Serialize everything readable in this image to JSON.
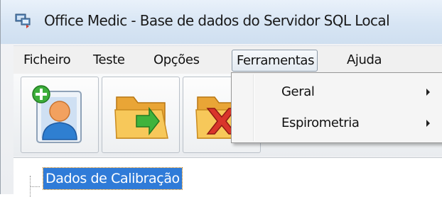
{
  "window": {
    "title": "Office Medic - Base de dados do Servidor SQL Local",
    "icon": "app-window-icon"
  },
  "menubar": {
    "items": [
      {
        "label": "Ficheiro"
      },
      {
        "label": "Teste"
      },
      {
        "label": "Opções"
      },
      {
        "label": "Ferramentas",
        "open": true
      },
      {
        "label": "Ajuda"
      }
    ]
  },
  "toolbar": {
    "buttons": [
      {
        "icon": "add-patient-icon"
      },
      {
        "icon": "open-folder-icon"
      },
      {
        "icon": "delete-icon"
      }
    ]
  },
  "dropdown": {
    "items": [
      {
        "label": "Geral",
        "submenu": true
      },
      {
        "label": "Espirometria",
        "submenu": true
      }
    ]
  },
  "tree": {
    "selected_node": "Dados de Calibração"
  },
  "colors": {
    "selection": "#2f7bd8",
    "titlebar": "#d7e5f4"
  }
}
